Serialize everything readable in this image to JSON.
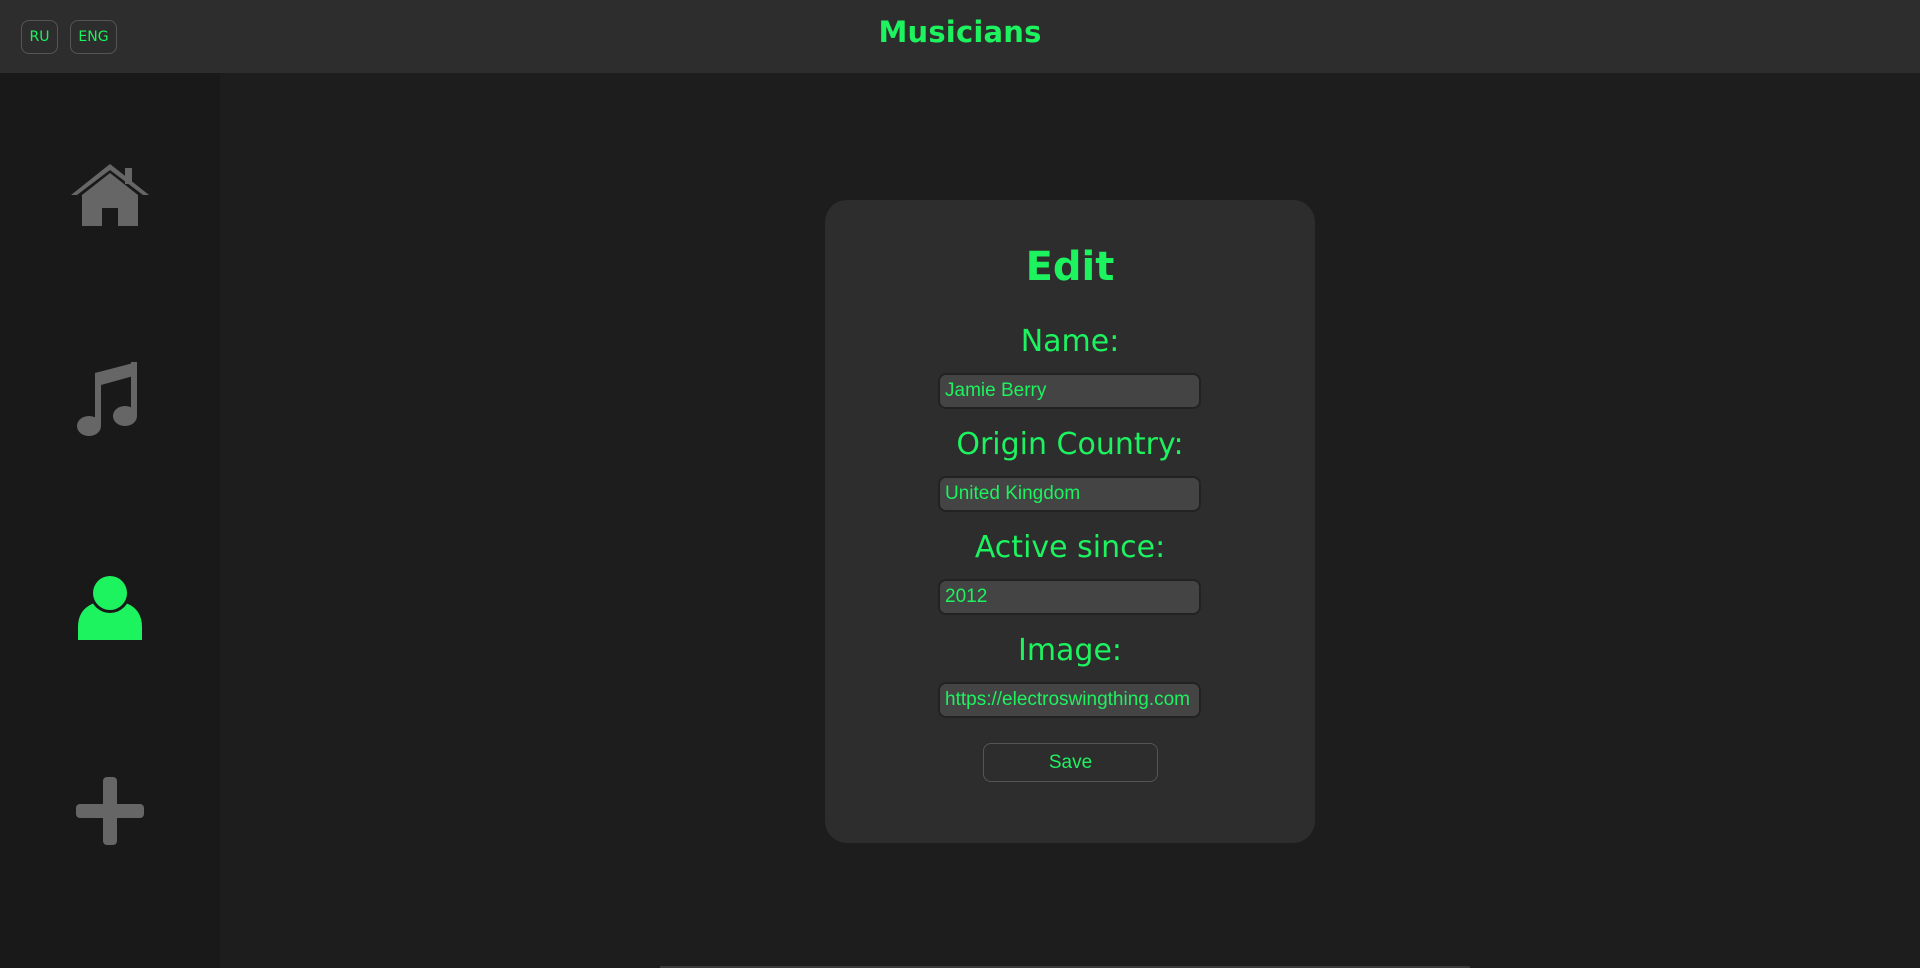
{
  "header": {
    "title": "Musicians",
    "lang_ru": "RU",
    "lang_eng": "ENG"
  },
  "sidebar": {
    "items": [
      {
        "name": "home",
        "icon": "home-icon",
        "active": false
      },
      {
        "name": "music",
        "icon": "music-note-icon",
        "active": false
      },
      {
        "name": "musicians",
        "icon": "person-icon",
        "active": true
      },
      {
        "name": "add",
        "icon": "plus-icon",
        "active": false
      }
    ]
  },
  "form": {
    "title": "Edit",
    "name_label": "Name:",
    "name_value": "Jamie Berry",
    "country_label": "Origin Country:",
    "country_value": "United Kingdom",
    "active_label": "Active since:",
    "active_value": "2012",
    "image_label": "Image:",
    "image_value": "https://electroswingthing.com",
    "save_label": "Save"
  },
  "colors": {
    "accent": "#1df25f",
    "icon_inactive": "#666666",
    "background": "#1d1d1d",
    "panel": "#2d2d2d"
  }
}
